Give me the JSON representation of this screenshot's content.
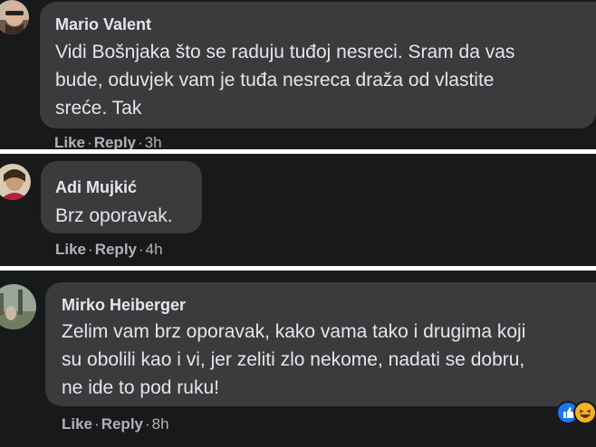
{
  "comments": [
    {
      "author": "Mario Valent",
      "text": "Vidi Bošnjaka što se raduju tuđoj nesreci. Sram da vas\nbude, oduvjek vam je tuđa nesreca draža od vlastite\nsreće. Tak",
      "like": "Like",
      "reply": "Reply",
      "time": "3h",
      "sep": "·"
    },
    {
      "author": "Adi Mujkić",
      "text": "Brz oporavak.",
      "like": "Like",
      "reply": "Reply",
      "time": "4h",
      "sep": "·"
    },
    {
      "author": "Mirko Heiberger",
      "text": "Zelim vam brz oporavak, kako vama tako i drugima koji\nsu obolili kao i vi, jer zeliti zlo nekome, nadati se dobru,\nne ide to pod ruku!",
      "like": "Like",
      "reply": "Reply",
      "time": "8h",
      "sep": "·",
      "reactions": [
        "like-reaction-icon",
        "haha-reaction-icon"
      ]
    }
  ],
  "colors": {
    "background": "#18191a",
    "bubble": "#3a3b3c",
    "text": "#e4e6eb",
    "meta": "#b0b3b8",
    "like_blue": "#1877f2",
    "haha_yellow": "#f7b125"
  }
}
